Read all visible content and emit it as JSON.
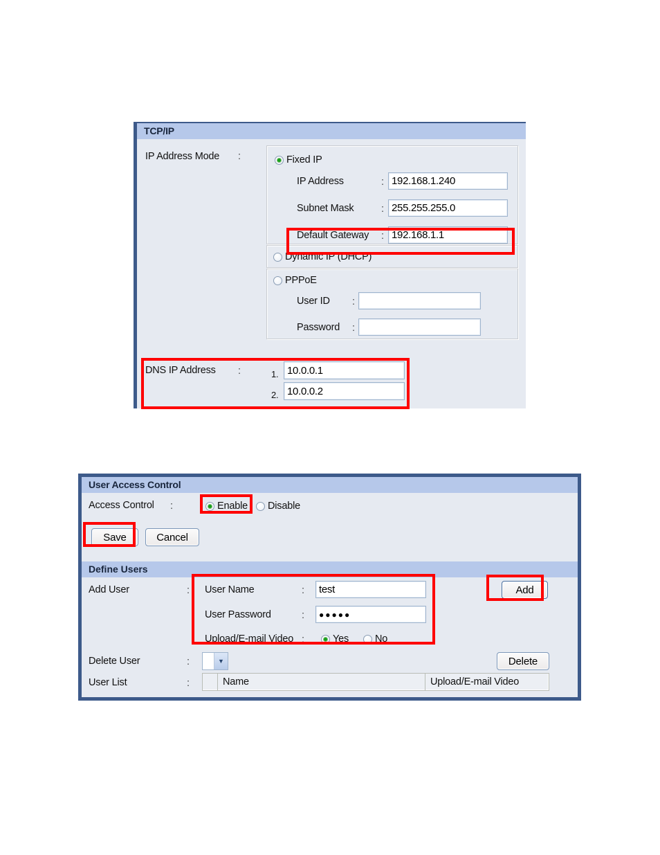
{
  "tcpip_panel": {
    "title": "TCP/IP",
    "ip_mode_label": "IP Address Mode",
    "colon": ":",
    "modes": {
      "fixed": {
        "label": "Fixed IP",
        "selected": true
      },
      "dhcp": {
        "label": "Dynamic IP (DHCP)",
        "selected": false
      },
      "pppoe": {
        "label": "PPPoE",
        "selected": false
      }
    },
    "fields": {
      "ip_address": {
        "label": "IP Address",
        "value": "192.168.1.240"
      },
      "subnet_mask": {
        "label": "Subnet Mask",
        "value": "255.255.255.0"
      },
      "default_gateway": {
        "label": "Default Gateway",
        "value": "192.168.1.1"
      },
      "user_id": {
        "label": "User ID",
        "value": ""
      },
      "password": {
        "label": "Password",
        "value": ""
      }
    },
    "dns": {
      "label": "DNS IP Address",
      "entry1_number": "1.",
      "entry1_value": "10.0.0.1",
      "entry2_number": "2.",
      "entry2_value": "10.0.0.2"
    }
  },
  "access_panel": {
    "title": "User Access Control",
    "access_control_label": "Access Control",
    "colon": ":",
    "enable_label": "Enable",
    "enable_selected": true,
    "disable_label": "Disable",
    "save_label": "Save",
    "cancel_label": "Cancel",
    "define_users_title": "Define Users",
    "add_user_label": "Add User",
    "user_name_label": "User Name",
    "user_name_value": "test",
    "user_password_label": "User Password",
    "user_password_value": "●●●●●",
    "upload_email_label": "Upload/E-mail Video",
    "upload_yes_label": "Yes",
    "upload_yes_selected": true,
    "upload_no_label": "No",
    "add_button_label": "Add",
    "delete_user_label": "Delete User",
    "delete_button_label": "Delete",
    "delete_user_selected": "",
    "user_list_label": "User List",
    "user_list_columns": [
      "",
      "Name",
      "Upload/E-mail Video"
    ],
    "user_list_rows": []
  },
  "colors": {
    "panel_bg": "#e6eaf1",
    "title_bar": "#b6c8ea",
    "panel_border": "#3d5a8a",
    "annotation_red": "#fe0000",
    "radio_dot_green": "#18a018"
  }
}
